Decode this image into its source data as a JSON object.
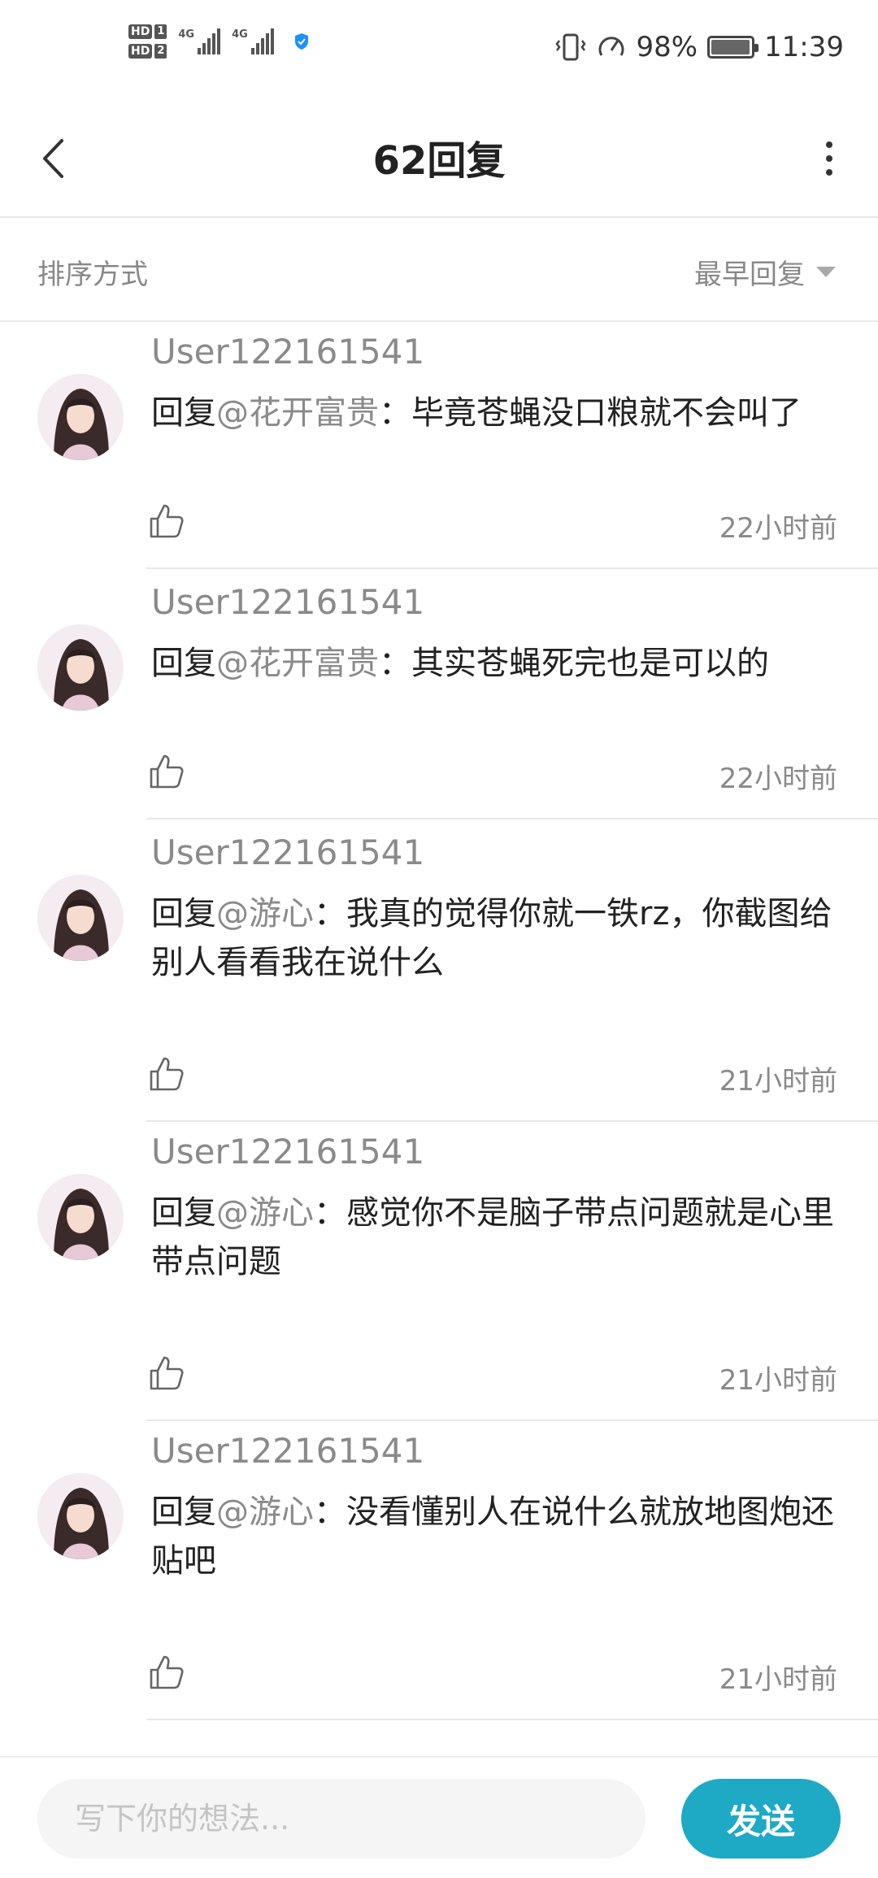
{
  "status_bar": {
    "sim1": "HD",
    "sim1_num": "1",
    "sim2": "HD",
    "sim2_num": "2",
    "net1": "4G",
    "net2": "4G",
    "battery_percent": "98%",
    "time": "11:39"
  },
  "header": {
    "title": "62回复"
  },
  "sort": {
    "label": "排序方式",
    "selected": "最早回复"
  },
  "comments": [
    {
      "username": "User122161541",
      "reply_prefix": "回复",
      "mention": "@花开富贵",
      "text": "：毕竟苍蝇没口粮就不会叫了",
      "time": "22小时前"
    },
    {
      "username": "User122161541",
      "reply_prefix": "回复",
      "mention": "@花开富贵",
      "text": "：其实苍蝇死完也是可以的",
      "time": "22小时前"
    },
    {
      "username": "User122161541",
      "reply_prefix": "回复",
      "mention": "@游心",
      "text": "：我真的觉得你就一铁rz，你截图给别人看看我在说什么",
      "time": "21小时前"
    },
    {
      "username": "User122161541",
      "reply_prefix": "回复",
      "mention": "@游心",
      "text": "：感觉你不是脑子带点问题就是心里带点问题",
      "time": "21小时前"
    },
    {
      "username": "User122161541",
      "reply_prefix": "回复",
      "mention": "@游心",
      "text": "：没看懂别人在说什么就放地图炮还贴吧",
      "time": "21小时前"
    }
  ],
  "composer": {
    "placeholder": "写下你的想法...",
    "send_label": "发送"
  }
}
